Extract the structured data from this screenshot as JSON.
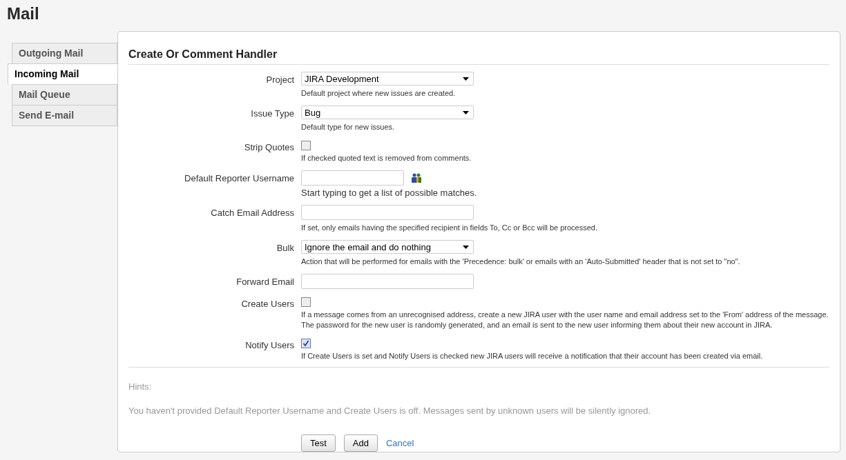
{
  "page_title": "Mail",
  "tabs": [
    {
      "label": "Outgoing Mail",
      "selected": false
    },
    {
      "label": "Incoming Mail",
      "selected": true
    },
    {
      "label": "Mail Queue",
      "selected": false
    },
    {
      "label": "Send E-mail",
      "selected": false
    }
  ],
  "form": {
    "title": "Create Or Comment Handler",
    "fields": [
      {
        "kind": "select",
        "label": "Project",
        "value": "JIRA Development",
        "help": "Default project where new issues are created."
      },
      {
        "kind": "select",
        "label": "Issue Type",
        "value": "Bug",
        "help": "Default type for new issues."
      },
      {
        "kind": "checkbox",
        "label": "Strip Quotes",
        "checked": false,
        "help": "If checked quoted text is removed from comments."
      },
      {
        "kind": "user",
        "label": "Default Reporter Username",
        "help": "Start typing to get a list of possible matches."
      },
      {
        "kind": "text",
        "label": "Catch Email Address",
        "help": "If set, only emails having the specified recipient in fields To, Cc or Bcc will be processed."
      },
      {
        "kind": "select",
        "label": "Bulk",
        "value": "Ignore the email and do nothing",
        "help": "Action that will be performed for emails with the 'Precedence: bulk' or emails with an 'Auto-Submitted' header that is not set to \"no\"."
      },
      {
        "kind": "text",
        "label": "Forward Email"
      },
      {
        "kind": "checkbox",
        "label": "Create Users",
        "checked": false,
        "help": "If a message comes from an unrecognised address, create a new JIRA user with the user name and email address set to the 'From' address of the message. The password for the new user is randomly generated, and an email is sent to the new user informing them about their new account in JIRA."
      },
      {
        "kind": "checkbox",
        "label": "Notify Users",
        "checked": true,
        "help": "If Create Users is set and Notify Users is checked new JIRA users will receive a notification that their account has been created via email."
      }
    ],
    "hints_title": "Hints:",
    "hints": [
      "You haven't provided Default Reporter Username and Create Users is off. Messages sent by unknown users will be silently ignored."
    ],
    "buttons": [
      "Test",
      "Add"
    ],
    "cancel": "Cancel"
  }
}
